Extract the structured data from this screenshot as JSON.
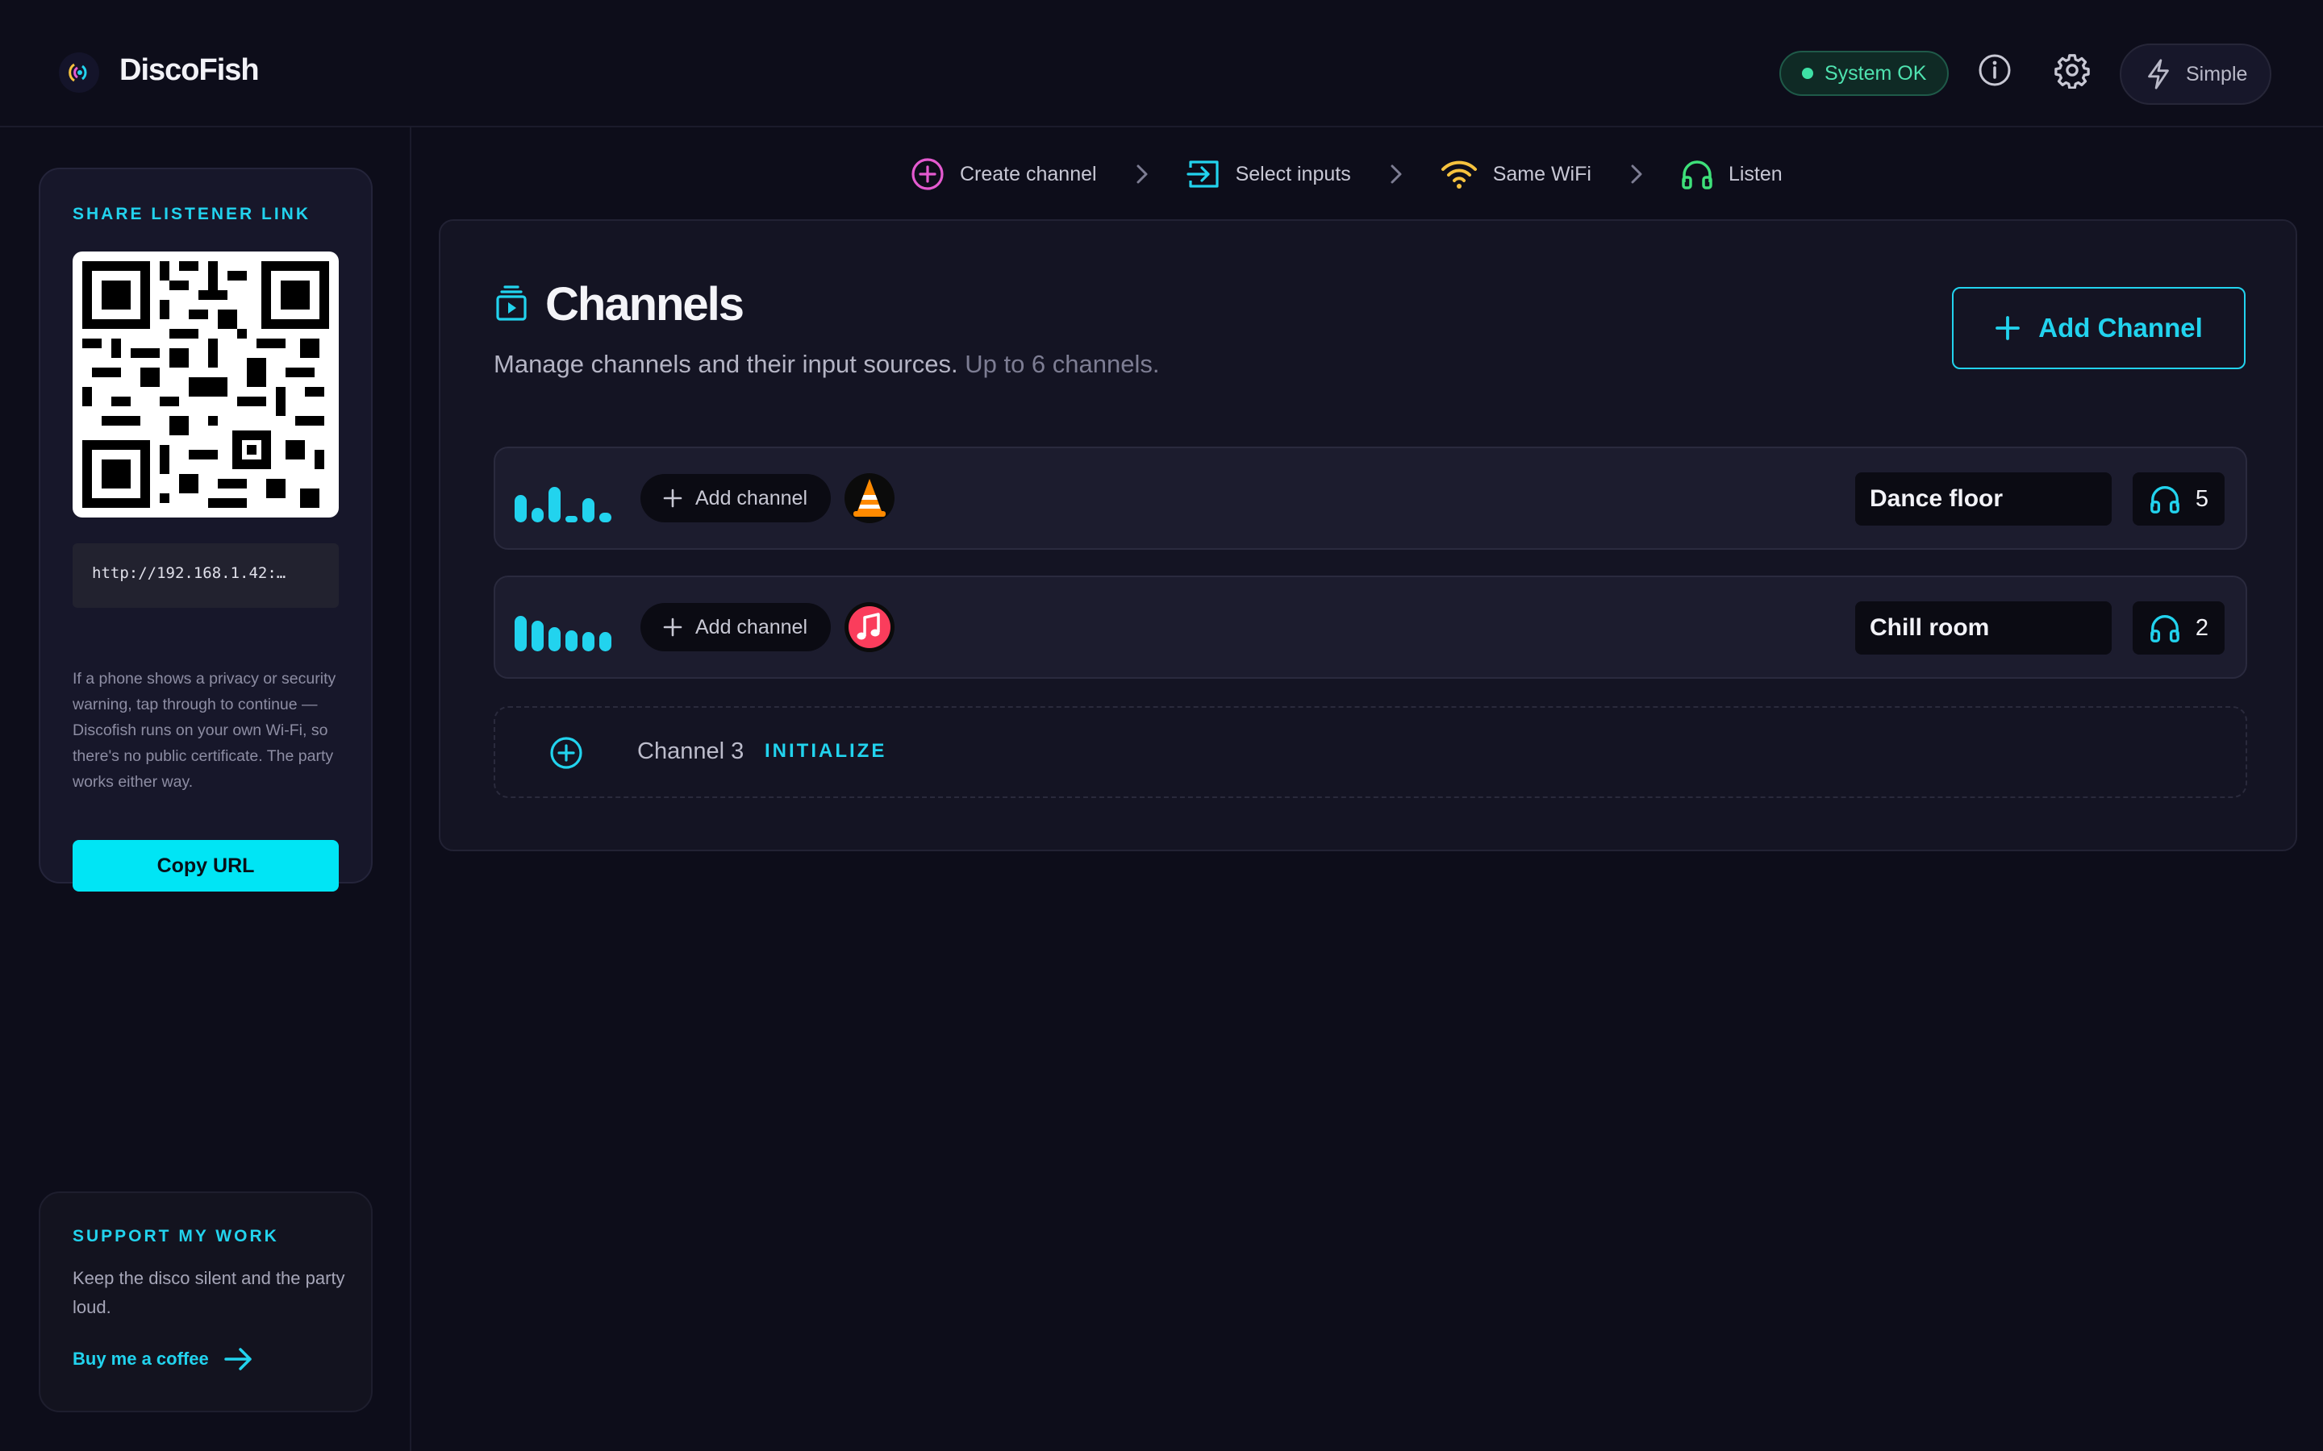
{
  "app": {
    "name": "DiscoFish"
  },
  "header": {
    "status": "System OK",
    "mode_label": "Simple",
    "icons": [
      "info-icon",
      "gear-icon",
      "bolt-icon"
    ]
  },
  "colors": {
    "accent": "#22d3ee",
    "status_ok": "#3ee0a5",
    "background": "#0d0d1a"
  },
  "sidebar": {
    "share_heading": "SHARE LISTENER LINK",
    "url": "http://192.168.1.42:…",
    "hint": "If a phone shows a privacy or security warning, tap through to continue — Discofish runs on your own Wi-Fi, so there's no public certificate. The party works either way.",
    "copy_label": "Copy URL",
    "support_heading": "SUPPORT MY WORK",
    "support_text": "Keep the disco silent and the party loud.",
    "coffee_label": "Buy me a coffee"
  },
  "steps": [
    {
      "label": "Create channel",
      "icon": "plus-circle-icon"
    },
    {
      "label": "Select inputs",
      "icon": "input-icon"
    },
    {
      "label": "Same WiFi",
      "icon": "wifi-icon"
    },
    {
      "label": "Listen",
      "icon": "headphones-icon"
    }
  ],
  "channels_page": {
    "title": "Channels",
    "subtitle": "Manage channels and their input sources.",
    "subtitle_muted": "Up to 6 channels.",
    "add_button": "Add Channel"
  },
  "channels": [
    {
      "add_label": "Add channel",
      "source_icon": "vlc-icon",
      "name": "Dance floor",
      "listeners": "5"
    },
    {
      "add_label": "Add channel",
      "source_icon": "apple-music-icon",
      "name": "Chill room",
      "listeners": "2"
    }
  ],
  "empty_slot": {
    "label": "Channel 3",
    "action": "INITIALIZE"
  }
}
